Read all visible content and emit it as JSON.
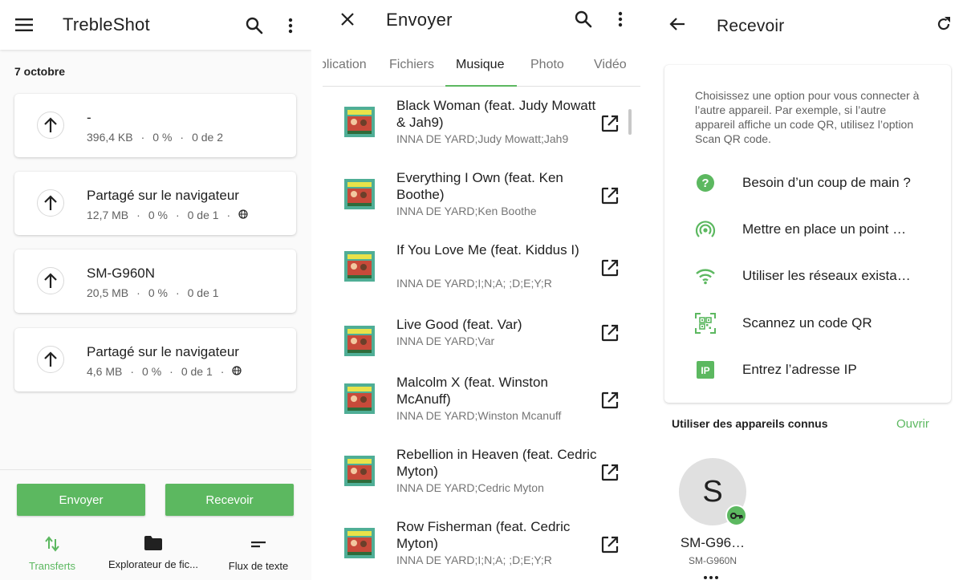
{
  "colors": {
    "accent": "#5cb860",
    "text_primary": "#212121",
    "text_secondary": "#757575"
  },
  "transfers": {
    "app_title": "TrebleShot",
    "date_header": "7 octobre",
    "items": [
      {
        "title": "-",
        "size": "396,4 KB",
        "percent": "0 %",
        "progress": "0 de 2",
        "web": false
      },
      {
        "title": "Partagé sur le navigateur",
        "size": "12,7 MB",
        "percent": "0 %",
        "progress": "0 de 1",
        "web": true
      },
      {
        "title": "SM-G960N",
        "size": "20,5 MB",
        "percent": "0 %",
        "progress": "0 de 1",
        "web": false
      },
      {
        "title": "Partagé sur le navigateur",
        "size": "4,6 MB",
        "percent": "0 %",
        "progress": "0 de 1",
        "web": true
      }
    ],
    "send_label": "Envoyer",
    "receive_label": "Recevoir",
    "bottom_nav": [
      {
        "label": "Transferts",
        "icon": "swap-vert-icon",
        "active": true
      },
      {
        "label": "Explorateur de fic...",
        "icon": "folder-icon",
        "active": false
      },
      {
        "label": "Flux de texte",
        "icon": "short-text-icon",
        "active": false
      }
    ]
  },
  "send": {
    "title": "Envoyer",
    "tabs": [
      "plication",
      "Fichiers",
      "Musique",
      "Photo",
      "Vidéo"
    ],
    "active_tab": "Musique",
    "songs": [
      {
        "title": "Black Woman (feat. Judy Mowatt & Jah9)",
        "artist": "INNA DE YARD;Judy Mowatt;Jah9"
      },
      {
        "title": "Everything I Own (feat. Ken Boothe)",
        "artist": "INNA DE YARD;Ken Boothe"
      },
      {
        "title": "If You Love Me (feat. Kiddus I)",
        "artist": "INNA DE YARD;I;N;A; ;D;E;Y;R"
      },
      {
        "title": "Live Good (feat. Var)",
        "artist": "INNA DE YARD;Var"
      },
      {
        "title": "Malcolm X (feat. Winston McAnuff)",
        "artist": "INNA DE YARD;Winston Mcanuff"
      },
      {
        "title": "Rebellion in Heaven (feat. Cedric Myton)",
        "artist": "INNA DE YARD;Cedric Myton"
      },
      {
        "title": "Row Fisherman (feat. Cedric Myton)",
        "artist": "INNA DE YARD;I;N;A; ;D;E;Y;R"
      }
    ]
  },
  "receive": {
    "title": "Recevoir",
    "description": "Choisissez une option pour vous connecter à l’autre appareil. Par exemple, si l’autre appareil affiche un code QR, utilisez l’option Scan QR code.",
    "options": [
      {
        "label": "Besoin d’un coup de main ?",
        "icon": "help-icon"
      },
      {
        "label": "Mettre en place un point …",
        "icon": "hotspot-icon"
      },
      {
        "label": "Utiliser les réseaux exista…",
        "icon": "wifi-icon"
      },
      {
        "label": "Scannez un code QR",
        "icon": "qr-scan-icon"
      },
      {
        "label": "Entrez l’adresse IP",
        "icon": "ip-icon"
      }
    ],
    "known_devices_header": "Utiliser des appareils connus",
    "known_devices_open": "Ouvrir",
    "device": {
      "initial": "S",
      "name": "SM-G96…",
      "model": "SM-G960N"
    },
    "ip_badge": "IP"
  }
}
